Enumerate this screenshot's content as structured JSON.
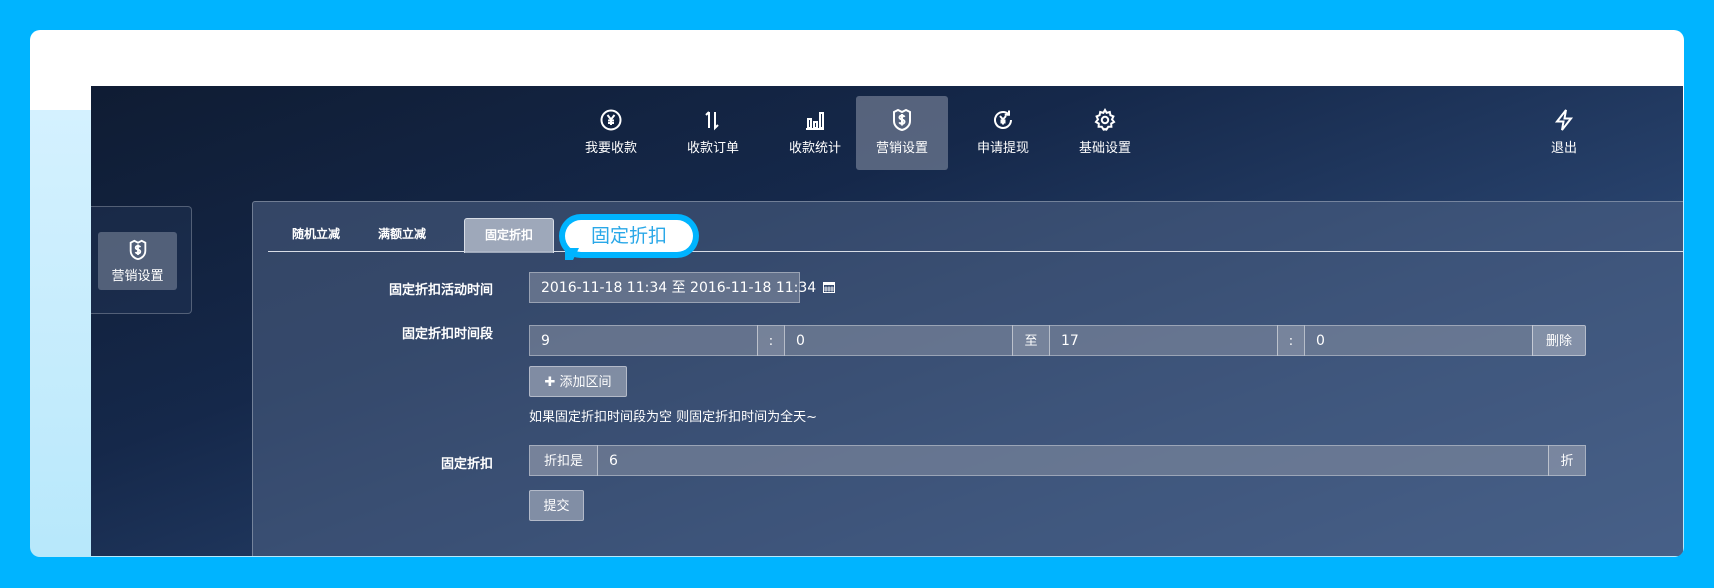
{
  "nav": {
    "items": [
      {
        "label": "我要收款",
        "icon": "yen-circle-icon"
      },
      {
        "label": "收款订单",
        "icon": "sort-arrows-icon"
      },
      {
        "label": "收款统计",
        "icon": "bar-chart-icon"
      },
      {
        "label": "营销设置",
        "icon": "shield-dollar-icon",
        "active": true
      },
      {
        "label": "申请提现",
        "icon": "yen-refresh-icon"
      },
      {
        "label": "基础设置",
        "icon": "gear-icon"
      }
    ],
    "logout": {
      "label": "退出",
      "icon": "bolt-icon"
    }
  },
  "sidebar": {
    "label": "营销设置",
    "icon": "shield-dollar-icon"
  },
  "callout": {
    "text": "固定折扣"
  },
  "tabs": [
    {
      "label": "随机立减"
    },
    {
      "label": "满额立减"
    },
    {
      "label": "固定折扣",
      "active": true
    }
  ],
  "form": {
    "activity_time": {
      "label": "固定折扣活动时间",
      "value": "2016-11-18 11:34 至 2016-11-18 11:34"
    },
    "time_period": {
      "label": "固定折扣时间段",
      "start_hour": "9",
      "sep1": ":",
      "start_min": "0",
      "to": "至",
      "end_hour": "17",
      "sep2": ":",
      "end_min": "0",
      "delete_label": "删除",
      "add_label": "添加区间",
      "hint": "如果固定折扣时间段为空 则固定折扣时间为全天~"
    },
    "discount": {
      "label": "固定折扣",
      "prefix": "折扣是",
      "value": "6",
      "suffix": "折"
    },
    "submit_label": "提交"
  },
  "colors": {
    "outer_bg": "#00b4ff",
    "callout_text": "#2aa8e8"
  }
}
